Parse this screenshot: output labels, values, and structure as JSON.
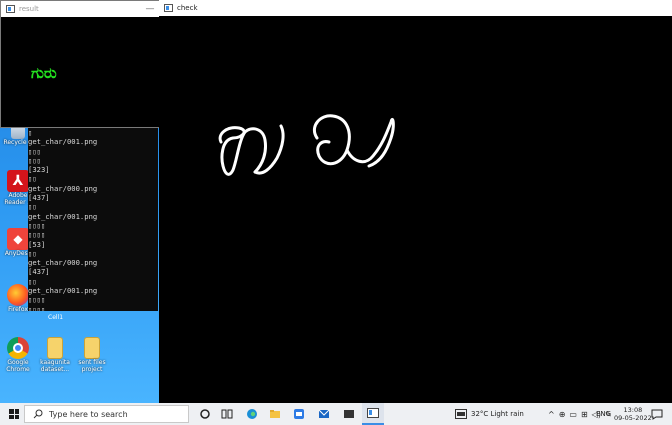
{
  "result_window": {
    "title": "result",
    "minimize": "—",
    "output_text": "ಗುರು"
  },
  "check_window": {
    "title": "check"
  },
  "console": {
    "lines": [
      "▯",
      "get_char/001.png",
      "▯▯▯",
      "▯▯▯",
      "[323]",
      "▯▯",
      "get_char/000.png",
      "[437]",
      "▯▯",
      "get_char/001.png",
      "▯▯▯▯",
      "▯▯▯▯",
      "[53]",
      "▯▯",
      "get_char/000.png",
      "[437]",
      "▯▯",
      "get_char/001.png",
      "▯▯▯▯",
      "▯▯▯▯"
    ]
  },
  "desktop_icons": [
    {
      "label": "Recycle B"
    },
    {
      "label": "Adobe Reader X"
    },
    {
      "label": "AnyDesk"
    },
    {
      "label": "Firefox"
    },
    {
      "label": "Google Chrome"
    },
    {
      "label": "kaagunita dataset..."
    },
    {
      "label": "sent files project"
    }
  ],
  "desktop_partial_label": "Cell1",
  "taskbar": {
    "search_placeholder": "Type here to search",
    "weather": "32°C  Light rain",
    "language": "ENG",
    "time": "13:08",
    "date": "09-05-2022"
  },
  "colors": {
    "result_text": "#23e01f",
    "desktop_top": "#1f7bd8",
    "taskbar": "#eef0f3"
  }
}
